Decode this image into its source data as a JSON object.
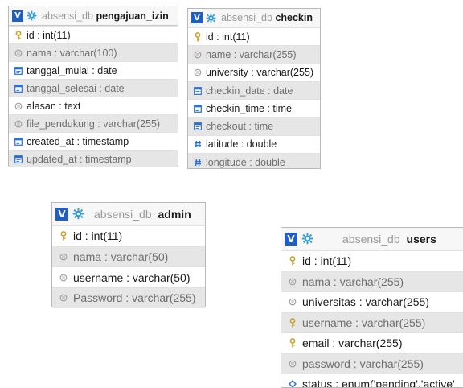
{
  "colors": {
    "view_button_bg": "#1f5fc4",
    "gear_icon": "#2e9bd8",
    "key_icon": "#c9a227",
    "type_icon": "#2b6fd6",
    "muted_row_bg": "#e6e6e6",
    "border": "#b9b9b9"
  },
  "tables": [
    {
      "id": "pengajuan",
      "view_label": "V",
      "db": "absensi_db",
      "name": "pengajuan_izin",
      "columns": [
        {
          "text": "id : int(11)",
          "icon": "key-icon",
          "muted": false
        },
        {
          "text": "nama : varchar(100)",
          "icon": "text-column-icon",
          "muted": true
        },
        {
          "text": "tanggal_mulai : date",
          "icon": "date-column-icon",
          "muted": false
        },
        {
          "text": "tanggal_selesai : date",
          "icon": "date-column-icon",
          "muted": true
        },
        {
          "text": "alasan : text",
          "icon": "text-column-icon",
          "muted": false
        },
        {
          "text": "file_pendukung : varchar(255)",
          "icon": "text-column-icon",
          "muted": true
        },
        {
          "text": "created_at : timestamp",
          "icon": "date-column-icon",
          "muted": false
        },
        {
          "text": "updated_at : timestamp",
          "icon": "date-column-icon",
          "muted": true
        }
      ]
    },
    {
      "id": "checkin",
      "view_label": "V",
      "db": "absensi_db",
      "name": "checkin",
      "columns": [
        {
          "text": "id : int(11)",
          "icon": "key-icon",
          "muted": false
        },
        {
          "text": "name : varchar(255)",
          "icon": "text-column-icon",
          "muted": true
        },
        {
          "text": "university : varchar(255)",
          "icon": "text-column-icon",
          "muted": false
        },
        {
          "text": "checkin_date : date",
          "icon": "date-column-icon",
          "muted": true
        },
        {
          "text": "checkin_time : time",
          "icon": "date-column-icon",
          "muted": false
        },
        {
          "text": "checkout : time",
          "icon": "date-column-icon",
          "muted": true
        },
        {
          "text": "latitude : double",
          "icon": "number-column-icon",
          "muted": false
        },
        {
          "text": "longitude : double",
          "icon": "number-column-icon",
          "muted": true
        }
      ]
    },
    {
      "id": "admin",
      "view_label": "V",
      "db": "absensi_db",
      "name": "admin",
      "columns": [
        {
          "text": "id : int(11)",
          "icon": "key-icon",
          "muted": false
        },
        {
          "text": "nama : varchar(50)",
          "icon": "text-column-icon",
          "muted": true
        },
        {
          "text": "username : varchar(50)",
          "icon": "text-column-icon",
          "muted": false
        },
        {
          "text": "Password : varchar(255)",
          "icon": "text-column-icon",
          "muted": true
        }
      ]
    },
    {
      "id": "users",
      "view_label": "V",
      "db": "absensi_db",
      "name": "users",
      "columns": [
        {
          "text": "id : int(11)",
          "icon": "key-icon",
          "muted": false
        },
        {
          "text": "nama : varchar(255)",
          "icon": "text-column-icon",
          "muted": true
        },
        {
          "text": "universitas : varchar(255)",
          "icon": "text-column-icon",
          "muted": false
        },
        {
          "text": "username : varchar(255)",
          "icon": "key-icon",
          "muted": true
        },
        {
          "text": "email : varchar(255)",
          "icon": "key-icon",
          "muted": false
        },
        {
          "text": "password : varchar(255)",
          "icon": "text-column-icon",
          "muted": true
        },
        {
          "text": "status : enum('pending','active'",
          "icon": "enum-column-icon",
          "muted": false
        }
      ]
    }
  ]
}
